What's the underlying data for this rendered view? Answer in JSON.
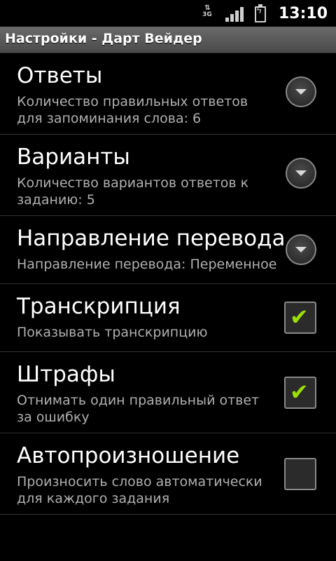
{
  "status_bar": {
    "network": "3G",
    "time": "13:10",
    "icons": [
      "3g-data-icon",
      "signal-icon",
      "battery-charging-icon"
    ]
  },
  "title_bar": {
    "title": "Настройки - Дарт Вейдер"
  },
  "preferences": [
    {
      "title": "Ответы",
      "summary": "Количество правильных ответов для запоминания слова: 6",
      "widget": "dropdown"
    },
    {
      "title": "Варианты",
      "summary": "Количество вариантов ответов к заданию: 5",
      "widget": "dropdown"
    },
    {
      "title": "Направление перевода",
      "summary": "Направление перевода: Переменное",
      "widget": "dropdown"
    },
    {
      "title": "Транскрипция",
      "summary": "Показывать транскрипцию",
      "widget": "checkbox",
      "checked": true
    },
    {
      "title": "Штрафы",
      "summary": "Отнимать один правильный ответ за ошибку",
      "widget": "checkbox",
      "checked": true
    },
    {
      "title": "Автопроизношение",
      "summary": "Произносить слово автоматически для каждого задания",
      "widget": "checkbox",
      "checked": false
    }
  ],
  "colors": {
    "background": "#000000",
    "checkmark": "#9be000",
    "summary_text": "#b0b0b0"
  }
}
